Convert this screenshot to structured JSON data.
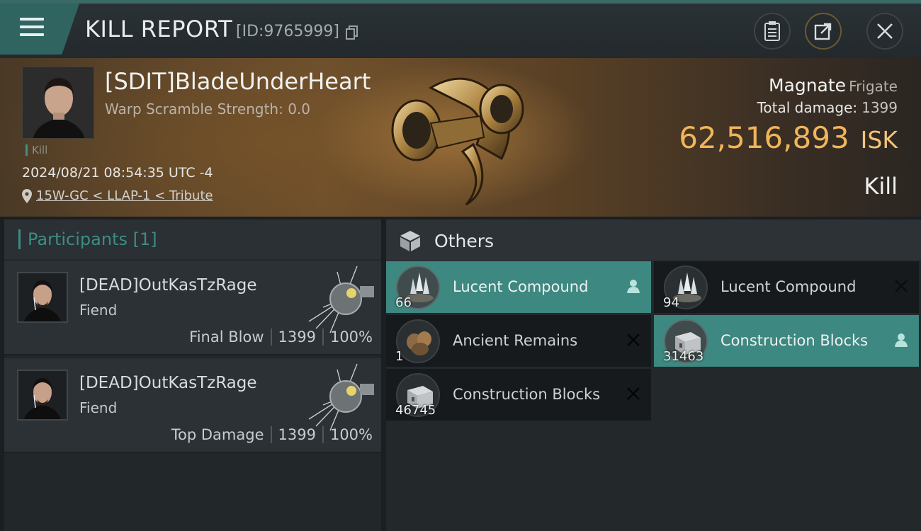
{
  "header": {
    "title": "KILL REPORT",
    "report_id": "[ID:9765999]",
    "buttons": [
      "clipboard-icon",
      "share-icon",
      "close-icon"
    ]
  },
  "victim": {
    "name": "[SDIT]BladeUnderHeart",
    "warp_scramble": "Warp Scramble Strength: 0.0",
    "tag": "Kill",
    "datetime": "2024/08/21 08:54:35 UTC -4",
    "location": "15W-GC < LLAP-1 < Tribute",
    "ship_name": "Magnate",
    "ship_class": "Frigate",
    "total_damage_label": "Total damage:",
    "total_damage_value": "1399",
    "isk_value": "62,516,893",
    "isk_unit": "ISK",
    "result": "Kill"
  },
  "participants": {
    "title": "Participants [1]",
    "rows": [
      {
        "name": "[DEAD]OutKasTzRage",
        "ship": "Fiend",
        "label": "Final Blow",
        "damage": "1399",
        "percent": "100%"
      },
      {
        "name": "[DEAD]OutKasTzRage",
        "ship": "Fiend",
        "label": "Top Damage",
        "damage": "1399",
        "percent": "100%"
      }
    ]
  },
  "others": {
    "title": "Others",
    "items": [
      {
        "name": "Lucent Compound",
        "qty": "66",
        "status": "dropped",
        "highlight": true
      },
      {
        "name": "Lucent Compound",
        "qty": "94",
        "status": "destroyed",
        "highlight": false
      },
      {
        "name": "Ancient Remains",
        "qty": "1",
        "status": "destroyed",
        "highlight": false
      },
      {
        "name": "Construction Blocks",
        "qty": "31463",
        "status": "dropped",
        "highlight": true
      },
      {
        "name": "Construction Blocks",
        "qty": "46745",
        "status": "destroyed",
        "highlight": false
      }
    ]
  },
  "colors": {
    "accent_teal": "#3d8880",
    "isk_gold": "#f0b55a",
    "panel_bg": "#222729"
  }
}
